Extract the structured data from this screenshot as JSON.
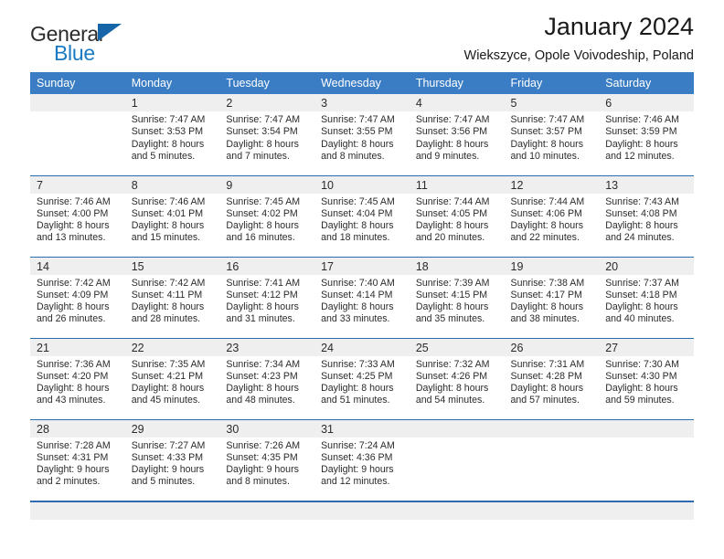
{
  "brand": {
    "name_top": "General",
    "name_bottom": "Blue",
    "triangle_icon": "triangle-logo-icon"
  },
  "header": {
    "title": "January 2024",
    "subtitle": "Wiekszyce, Opole Voivodeship, Poland"
  },
  "calendar": {
    "weekday_headers": [
      "Sunday",
      "Monday",
      "Tuesday",
      "Wednesday",
      "Thursday",
      "Friday",
      "Saturday"
    ],
    "colors": {
      "header_blue": "#3b7dc4",
      "rule_blue": "#2b6cb0",
      "daynum_band_gray": "#efefef",
      "brand_blue": "#1a7ac4",
      "text": "#2b2b2b"
    },
    "weeks": [
      [
        {
          "day": "",
          "sunrise": "",
          "sunset": "",
          "daylight_line1": "",
          "daylight_line2": "",
          "empty": true
        },
        {
          "day": "1",
          "sunrise": "Sunrise: 7:47 AM",
          "sunset": "Sunset: 3:53 PM",
          "daylight_line1": "Daylight: 8 hours",
          "daylight_line2": "and 5 minutes.",
          "empty": false
        },
        {
          "day": "2",
          "sunrise": "Sunrise: 7:47 AM",
          "sunset": "Sunset: 3:54 PM",
          "daylight_line1": "Daylight: 8 hours",
          "daylight_line2": "and 7 minutes.",
          "empty": false
        },
        {
          "day": "3",
          "sunrise": "Sunrise: 7:47 AM",
          "sunset": "Sunset: 3:55 PM",
          "daylight_line1": "Daylight: 8 hours",
          "daylight_line2": "and 8 minutes.",
          "empty": false
        },
        {
          "day": "4",
          "sunrise": "Sunrise: 7:47 AM",
          "sunset": "Sunset: 3:56 PM",
          "daylight_line1": "Daylight: 8 hours",
          "daylight_line2": "and 9 minutes.",
          "empty": false
        },
        {
          "day": "5",
          "sunrise": "Sunrise: 7:47 AM",
          "sunset": "Sunset: 3:57 PM",
          "daylight_line1": "Daylight: 8 hours",
          "daylight_line2": "and 10 minutes.",
          "empty": false
        },
        {
          "day": "6",
          "sunrise": "Sunrise: 7:46 AM",
          "sunset": "Sunset: 3:59 PM",
          "daylight_line1": "Daylight: 8 hours",
          "daylight_line2": "and 12 minutes.",
          "empty": false
        }
      ],
      [
        {
          "day": "7",
          "sunrise": "Sunrise: 7:46 AM",
          "sunset": "Sunset: 4:00 PM",
          "daylight_line1": "Daylight: 8 hours",
          "daylight_line2": "and 13 minutes.",
          "empty": false
        },
        {
          "day": "8",
          "sunrise": "Sunrise: 7:46 AM",
          "sunset": "Sunset: 4:01 PM",
          "daylight_line1": "Daylight: 8 hours",
          "daylight_line2": "and 15 minutes.",
          "empty": false
        },
        {
          "day": "9",
          "sunrise": "Sunrise: 7:45 AM",
          "sunset": "Sunset: 4:02 PM",
          "daylight_line1": "Daylight: 8 hours",
          "daylight_line2": "and 16 minutes.",
          "empty": false
        },
        {
          "day": "10",
          "sunrise": "Sunrise: 7:45 AM",
          "sunset": "Sunset: 4:04 PM",
          "daylight_line1": "Daylight: 8 hours",
          "daylight_line2": "and 18 minutes.",
          "empty": false
        },
        {
          "day": "11",
          "sunrise": "Sunrise: 7:44 AM",
          "sunset": "Sunset: 4:05 PM",
          "daylight_line1": "Daylight: 8 hours",
          "daylight_line2": "and 20 minutes.",
          "empty": false
        },
        {
          "day": "12",
          "sunrise": "Sunrise: 7:44 AM",
          "sunset": "Sunset: 4:06 PM",
          "daylight_line1": "Daylight: 8 hours",
          "daylight_line2": "and 22 minutes.",
          "empty": false
        },
        {
          "day": "13",
          "sunrise": "Sunrise: 7:43 AM",
          "sunset": "Sunset: 4:08 PM",
          "daylight_line1": "Daylight: 8 hours",
          "daylight_line2": "and 24 minutes.",
          "empty": false
        }
      ],
      [
        {
          "day": "14",
          "sunrise": "Sunrise: 7:42 AM",
          "sunset": "Sunset: 4:09 PM",
          "daylight_line1": "Daylight: 8 hours",
          "daylight_line2": "and 26 minutes.",
          "empty": false
        },
        {
          "day": "15",
          "sunrise": "Sunrise: 7:42 AM",
          "sunset": "Sunset: 4:11 PM",
          "daylight_line1": "Daylight: 8 hours",
          "daylight_line2": "and 28 minutes.",
          "empty": false
        },
        {
          "day": "16",
          "sunrise": "Sunrise: 7:41 AM",
          "sunset": "Sunset: 4:12 PM",
          "daylight_line1": "Daylight: 8 hours",
          "daylight_line2": "and 31 minutes.",
          "empty": false
        },
        {
          "day": "17",
          "sunrise": "Sunrise: 7:40 AM",
          "sunset": "Sunset: 4:14 PM",
          "daylight_line1": "Daylight: 8 hours",
          "daylight_line2": "and 33 minutes.",
          "empty": false
        },
        {
          "day": "18",
          "sunrise": "Sunrise: 7:39 AM",
          "sunset": "Sunset: 4:15 PM",
          "daylight_line1": "Daylight: 8 hours",
          "daylight_line2": "and 35 minutes.",
          "empty": false
        },
        {
          "day": "19",
          "sunrise": "Sunrise: 7:38 AM",
          "sunset": "Sunset: 4:17 PM",
          "daylight_line1": "Daylight: 8 hours",
          "daylight_line2": "and 38 minutes.",
          "empty": false
        },
        {
          "day": "20",
          "sunrise": "Sunrise: 7:37 AM",
          "sunset": "Sunset: 4:18 PM",
          "daylight_line1": "Daylight: 8 hours",
          "daylight_line2": "and 40 minutes.",
          "empty": false
        }
      ],
      [
        {
          "day": "21",
          "sunrise": "Sunrise: 7:36 AM",
          "sunset": "Sunset: 4:20 PM",
          "daylight_line1": "Daylight: 8 hours",
          "daylight_line2": "and 43 minutes.",
          "empty": false
        },
        {
          "day": "22",
          "sunrise": "Sunrise: 7:35 AM",
          "sunset": "Sunset: 4:21 PM",
          "daylight_line1": "Daylight: 8 hours",
          "daylight_line2": "and 45 minutes.",
          "empty": false
        },
        {
          "day": "23",
          "sunrise": "Sunrise: 7:34 AM",
          "sunset": "Sunset: 4:23 PM",
          "daylight_line1": "Daylight: 8 hours",
          "daylight_line2": "and 48 minutes.",
          "empty": false
        },
        {
          "day": "24",
          "sunrise": "Sunrise: 7:33 AM",
          "sunset": "Sunset: 4:25 PM",
          "daylight_line1": "Daylight: 8 hours",
          "daylight_line2": "and 51 minutes.",
          "empty": false
        },
        {
          "day": "25",
          "sunrise": "Sunrise: 7:32 AM",
          "sunset": "Sunset: 4:26 PM",
          "daylight_line1": "Daylight: 8 hours",
          "daylight_line2": "and 54 minutes.",
          "empty": false
        },
        {
          "day": "26",
          "sunrise": "Sunrise: 7:31 AM",
          "sunset": "Sunset: 4:28 PM",
          "daylight_line1": "Daylight: 8 hours",
          "daylight_line2": "and 57 minutes.",
          "empty": false
        },
        {
          "day": "27",
          "sunrise": "Sunrise: 7:30 AM",
          "sunset": "Sunset: 4:30 PM",
          "daylight_line1": "Daylight: 8 hours",
          "daylight_line2": "and 59 minutes.",
          "empty": false
        }
      ],
      [
        {
          "day": "28",
          "sunrise": "Sunrise: 7:28 AM",
          "sunset": "Sunset: 4:31 PM",
          "daylight_line1": "Daylight: 9 hours",
          "daylight_line2": "and 2 minutes.",
          "empty": false
        },
        {
          "day": "29",
          "sunrise": "Sunrise: 7:27 AM",
          "sunset": "Sunset: 4:33 PM",
          "daylight_line1": "Daylight: 9 hours",
          "daylight_line2": "and 5 minutes.",
          "empty": false
        },
        {
          "day": "30",
          "sunrise": "Sunrise: 7:26 AM",
          "sunset": "Sunset: 4:35 PM",
          "daylight_line1": "Daylight: 9 hours",
          "daylight_line2": "and 8 minutes.",
          "empty": false
        },
        {
          "day": "31",
          "sunrise": "Sunrise: 7:24 AM",
          "sunset": "Sunset: 4:36 PM",
          "daylight_line1": "Daylight: 9 hours",
          "daylight_line2": "and 12 minutes.",
          "empty": false
        },
        {
          "day": "",
          "sunrise": "",
          "sunset": "",
          "daylight_line1": "",
          "daylight_line2": "",
          "empty": true
        },
        {
          "day": "",
          "sunrise": "",
          "sunset": "",
          "daylight_line1": "",
          "daylight_line2": "",
          "empty": true
        },
        {
          "day": "",
          "sunrise": "",
          "sunset": "",
          "daylight_line1": "",
          "daylight_line2": "",
          "empty": true
        }
      ]
    ]
  }
}
